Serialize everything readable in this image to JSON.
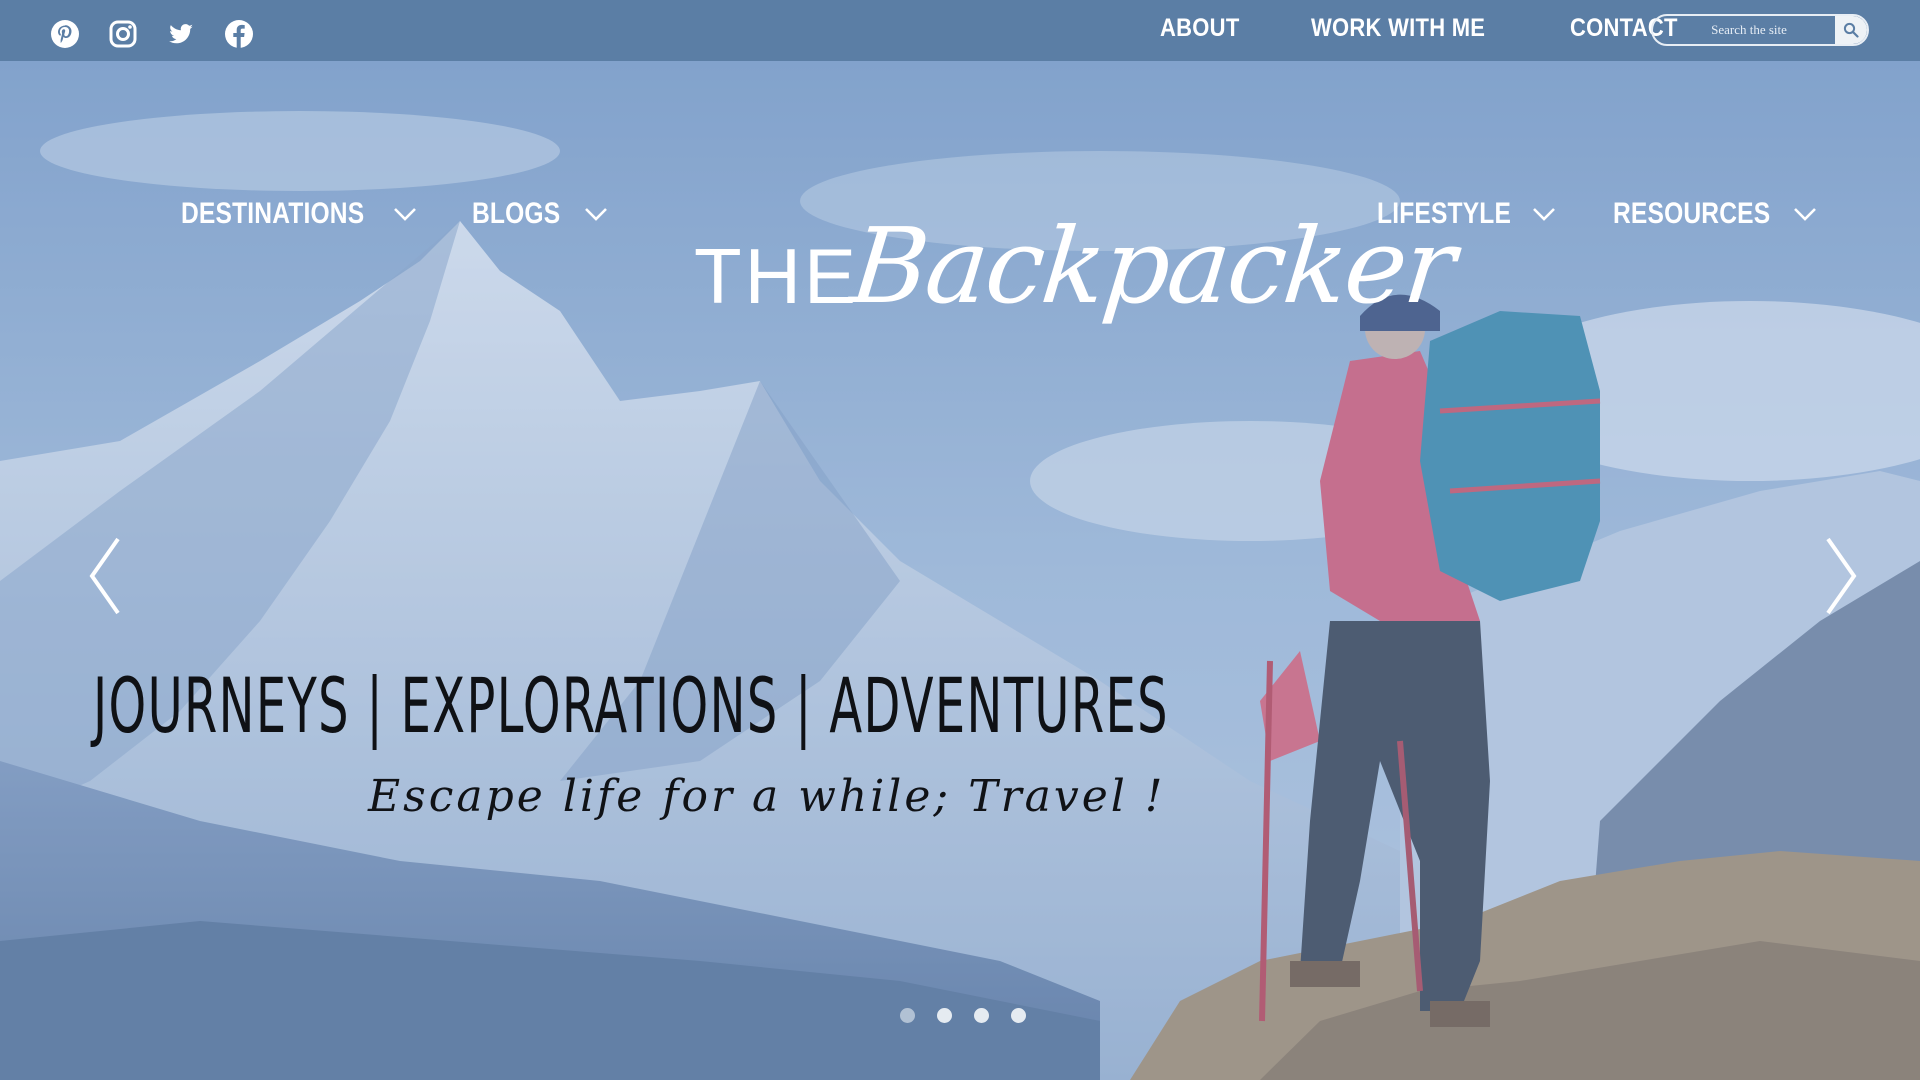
{
  "topbar": {
    "social": [
      {
        "icon": "pinterest-icon"
      },
      {
        "icon": "instagram-icon"
      },
      {
        "icon": "twitter-icon"
      },
      {
        "icon": "facebook-icon"
      }
    ],
    "nav": [
      "ABOUT",
      "WORK WITH ME",
      "CONTACT"
    ],
    "search": {
      "placeholder": "Search the site",
      "icon": "search-icon"
    }
  },
  "hero": {
    "menu_left": [
      "DESTINATIONS",
      "BLOGS"
    ],
    "menu_right": [
      "LIFESTYLE",
      "RESOURCES"
    ],
    "logo": {
      "the": "THE",
      "name": "Backpacker"
    },
    "tagline": "JOURNEYS | EXPLORATIONS | ADVENTURES",
    "subtagline": "Escape life for a while; Travel !",
    "slider": {
      "slides": 4,
      "active": 1,
      "prev_icon": "chevron-left-icon",
      "next_icon": "chevron-right-icon"
    }
  },
  "colors": {
    "topbar": "#5b7ea5",
    "text_light": "#ffffff",
    "text_dark": "#0f1115"
  }
}
